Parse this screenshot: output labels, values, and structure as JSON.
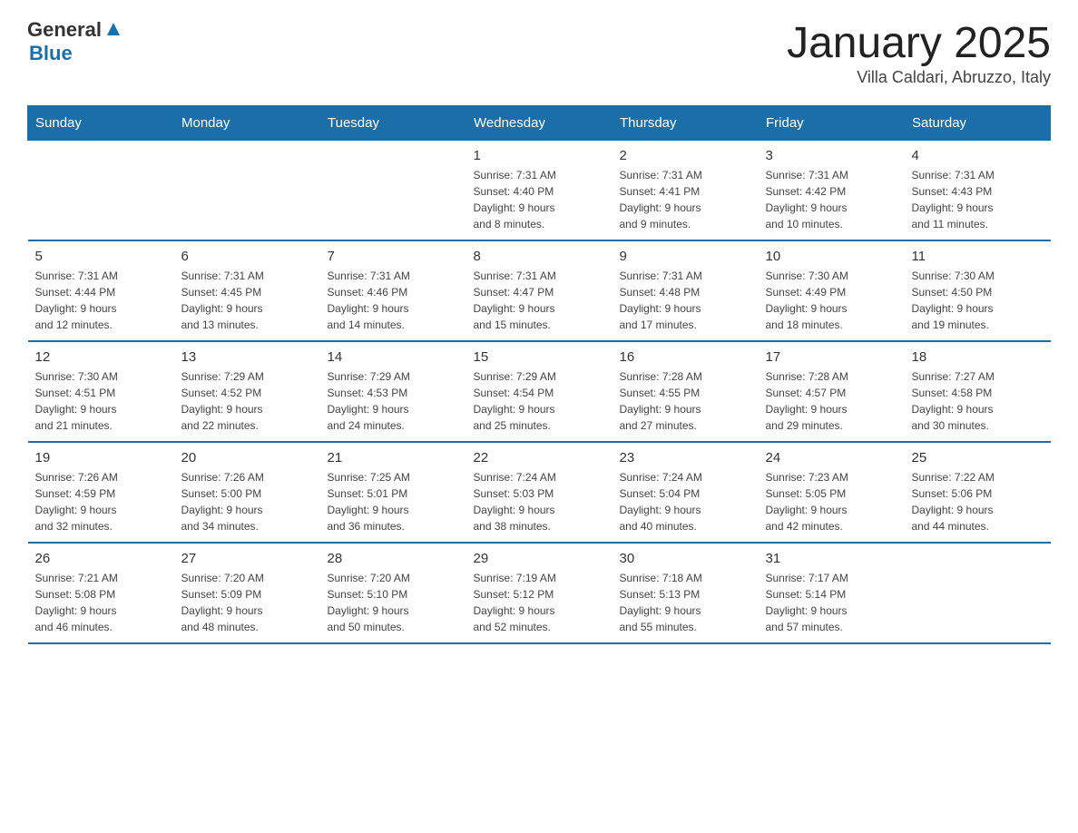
{
  "header": {
    "logo_general": "General",
    "logo_blue": "Blue",
    "title": "January 2025",
    "location": "Villa Caldari, Abruzzo, Italy"
  },
  "weekdays": [
    "Sunday",
    "Monday",
    "Tuesday",
    "Wednesday",
    "Thursday",
    "Friday",
    "Saturday"
  ],
  "weeks": [
    [
      {
        "day": "",
        "info": ""
      },
      {
        "day": "",
        "info": ""
      },
      {
        "day": "",
        "info": ""
      },
      {
        "day": "1",
        "info": "Sunrise: 7:31 AM\nSunset: 4:40 PM\nDaylight: 9 hours\nand 8 minutes."
      },
      {
        "day": "2",
        "info": "Sunrise: 7:31 AM\nSunset: 4:41 PM\nDaylight: 9 hours\nand 9 minutes."
      },
      {
        "day": "3",
        "info": "Sunrise: 7:31 AM\nSunset: 4:42 PM\nDaylight: 9 hours\nand 10 minutes."
      },
      {
        "day": "4",
        "info": "Sunrise: 7:31 AM\nSunset: 4:43 PM\nDaylight: 9 hours\nand 11 minutes."
      }
    ],
    [
      {
        "day": "5",
        "info": "Sunrise: 7:31 AM\nSunset: 4:44 PM\nDaylight: 9 hours\nand 12 minutes."
      },
      {
        "day": "6",
        "info": "Sunrise: 7:31 AM\nSunset: 4:45 PM\nDaylight: 9 hours\nand 13 minutes."
      },
      {
        "day": "7",
        "info": "Sunrise: 7:31 AM\nSunset: 4:46 PM\nDaylight: 9 hours\nand 14 minutes."
      },
      {
        "day": "8",
        "info": "Sunrise: 7:31 AM\nSunset: 4:47 PM\nDaylight: 9 hours\nand 15 minutes."
      },
      {
        "day": "9",
        "info": "Sunrise: 7:31 AM\nSunset: 4:48 PM\nDaylight: 9 hours\nand 17 minutes."
      },
      {
        "day": "10",
        "info": "Sunrise: 7:30 AM\nSunset: 4:49 PM\nDaylight: 9 hours\nand 18 minutes."
      },
      {
        "day": "11",
        "info": "Sunrise: 7:30 AM\nSunset: 4:50 PM\nDaylight: 9 hours\nand 19 minutes."
      }
    ],
    [
      {
        "day": "12",
        "info": "Sunrise: 7:30 AM\nSunset: 4:51 PM\nDaylight: 9 hours\nand 21 minutes."
      },
      {
        "day": "13",
        "info": "Sunrise: 7:29 AM\nSunset: 4:52 PM\nDaylight: 9 hours\nand 22 minutes."
      },
      {
        "day": "14",
        "info": "Sunrise: 7:29 AM\nSunset: 4:53 PM\nDaylight: 9 hours\nand 24 minutes."
      },
      {
        "day": "15",
        "info": "Sunrise: 7:29 AM\nSunset: 4:54 PM\nDaylight: 9 hours\nand 25 minutes."
      },
      {
        "day": "16",
        "info": "Sunrise: 7:28 AM\nSunset: 4:55 PM\nDaylight: 9 hours\nand 27 minutes."
      },
      {
        "day": "17",
        "info": "Sunrise: 7:28 AM\nSunset: 4:57 PM\nDaylight: 9 hours\nand 29 minutes."
      },
      {
        "day": "18",
        "info": "Sunrise: 7:27 AM\nSunset: 4:58 PM\nDaylight: 9 hours\nand 30 minutes."
      }
    ],
    [
      {
        "day": "19",
        "info": "Sunrise: 7:26 AM\nSunset: 4:59 PM\nDaylight: 9 hours\nand 32 minutes."
      },
      {
        "day": "20",
        "info": "Sunrise: 7:26 AM\nSunset: 5:00 PM\nDaylight: 9 hours\nand 34 minutes."
      },
      {
        "day": "21",
        "info": "Sunrise: 7:25 AM\nSunset: 5:01 PM\nDaylight: 9 hours\nand 36 minutes."
      },
      {
        "day": "22",
        "info": "Sunrise: 7:24 AM\nSunset: 5:03 PM\nDaylight: 9 hours\nand 38 minutes."
      },
      {
        "day": "23",
        "info": "Sunrise: 7:24 AM\nSunset: 5:04 PM\nDaylight: 9 hours\nand 40 minutes."
      },
      {
        "day": "24",
        "info": "Sunrise: 7:23 AM\nSunset: 5:05 PM\nDaylight: 9 hours\nand 42 minutes."
      },
      {
        "day": "25",
        "info": "Sunrise: 7:22 AM\nSunset: 5:06 PM\nDaylight: 9 hours\nand 44 minutes."
      }
    ],
    [
      {
        "day": "26",
        "info": "Sunrise: 7:21 AM\nSunset: 5:08 PM\nDaylight: 9 hours\nand 46 minutes."
      },
      {
        "day": "27",
        "info": "Sunrise: 7:20 AM\nSunset: 5:09 PM\nDaylight: 9 hours\nand 48 minutes."
      },
      {
        "day": "28",
        "info": "Sunrise: 7:20 AM\nSunset: 5:10 PM\nDaylight: 9 hours\nand 50 minutes."
      },
      {
        "day": "29",
        "info": "Sunrise: 7:19 AM\nSunset: 5:12 PM\nDaylight: 9 hours\nand 52 minutes."
      },
      {
        "day": "30",
        "info": "Sunrise: 7:18 AM\nSunset: 5:13 PM\nDaylight: 9 hours\nand 55 minutes."
      },
      {
        "day": "31",
        "info": "Sunrise: 7:17 AM\nSunset: 5:14 PM\nDaylight: 9 hours\nand 57 minutes."
      },
      {
        "day": "",
        "info": ""
      }
    ]
  ]
}
